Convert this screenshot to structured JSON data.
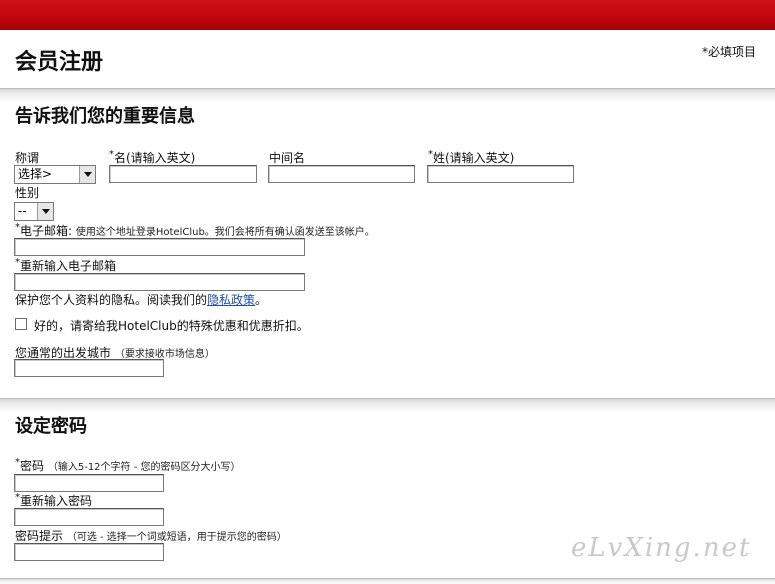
{
  "header": {
    "title": "会员注册",
    "required_note": "*必填项目"
  },
  "section_info": {
    "title": "告诉我们您的重要信息",
    "salutation_label": "称谓",
    "salutation_value": "选择>",
    "firstname_label": "名(请输入英文)",
    "middlename_label": "中间名",
    "lastname_label": "姓(请输入英文)",
    "gender_label": "性别",
    "gender_value": "--",
    "email_label": "电子邮箱:",
    "email_note": "使用这个地址登录HotelClub。我们会将所有确认函发送至该帐户。",
    "email_confirm_label": "重新输入电子邮箱",
    "privacy_text": "保护您个人资料的隐私。阅读我们的",
    "privacy_link": "隐私政策",
    "privacy_end": "。",
    "offers_label": "好的，请寄给我HotelClub的特殊优惠和优惠折扣。",
    "city_label": "您通常的出发城市",
    "city_note": "（要求接收市场信息）"
  },
  "section_password": {
    "title": "设定密码",
    "password_label": "密码",
    "password_note": "（输入5-12个字符 - 您的密码区分大小写）",
    "password_confirm_label": "重新输入密码",
    "hint_label": "密码提示",
    "hint_note": "（可选 - 选择一个词或短语，用于提示您的密码）"
  },
  "watermark": "eLvXing.net"
}
